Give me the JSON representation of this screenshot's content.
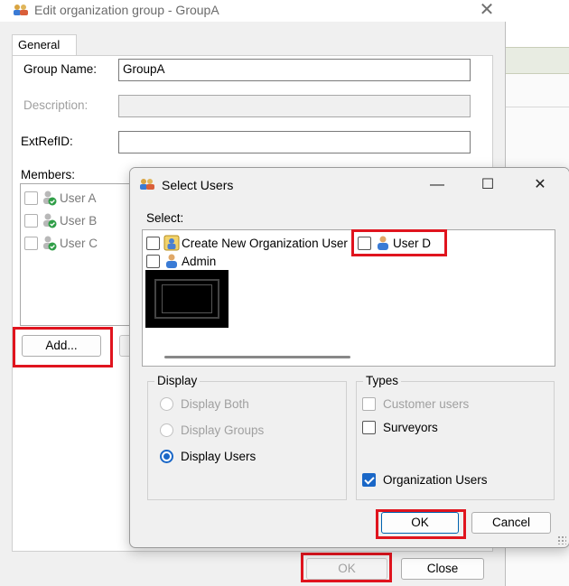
{
  "back_dialog": {
    "title": "Edit organization group - GroupA",
    "tab_general": "General",
    "group_name_label": "Group Name:",
    "group_name_value": "GroupA",
    "description_label": "Description:",
    "description_value": "",
    "extrefid_label": "ExtRefID:",
    "extrefid_value": "",
    "members_label": "Members:",
    "members": [
      {
        "label": "User A"
      },
      {
        "label": "User B"
      },
      {
        "label": "User C"
      }
    ],
    "add_button": "Add...",
    "ok_button": "OK",
    "close_button": "Close"
  },
  "select_dialog": {
    "title": "Select Users",
    "minimize_glyph": "—",
    "maximize_glyph": "☐",
    "close_glyph": "✕",
    "select_label": "Select:",
    "items": [
      {
        "label": "Create New Organization User"
      },
      {
        "label": "User D"
      },
      {
        "label": "Admin"
      }
    ],
    "display_group_title": "Display",
    "display_options": [
      "Display Both",
      "Display Groups",
      "Display Users"
    ],
    "display_selected": "Display Users",
    "types_group_title": "Types",
    "type_options": [
      {
        "label": "Customer users",
        "checked": false,
        "enabled": false
      },
      {
        "label": "Surveyors",
        "checked": false,
        "enabled": true
      },
      {
        "label": "Organization Users",
        "checked": true,
        "enabled": true
      }
    ],
    "ok_button": "OK",
    "cancel_button": "Cancel"
  },
  "colors": {
    "highlight": "#e0141e",
    "accent": "#1a67c7"
  }
}
